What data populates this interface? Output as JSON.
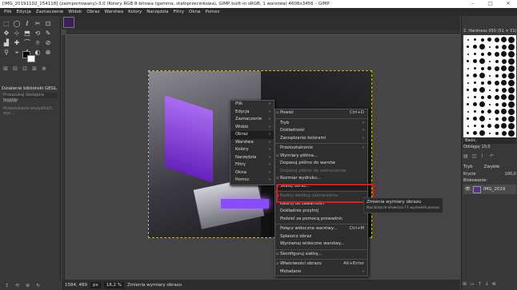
{
  "window": {
    "title": "[IMG_20191102_154118] (zaimportowany)-3.0 (Kolory RGB 8-bitowa (gamma, stałoprzecinkowa), GIMP built-in sRGB, 1 warstwa) 4608x3456 – GIMP",
    "minimize": "–",
    "maximize": "□",
    "close": "✕"
  },
  "menubar": [
    "Plik",
    "Edycja",
    "Zaznaczenie",
    "Widok",
    "Obraz",
    "Warstwa",
    "Kolory",
    "Narzędzia",
    "Filtry",
    "Okna",
    "Pomoc"
  ],
  "toolbox": {
    "tools": [
      "⬚",
      "◯",
      "ℓ",
      "✂",
      "⊡",
      "✥",
      "⊹",
      "⬒",
      "⟲",
      "✎",
      "▟",
      "✚",
      "⌒",
      "⌾",
      "⊘",
      "⚲",
      "⌖",
      "A",
      "◐",
      "⊕"
    ],
    "panel_icons": [
      "⊞",
      "⊟",
      "⊡",
      "⊠",
      "⊕"
    ],
    "gegl_title": "Działanie biblioteki GEGL",
    "gegl_search": "Przeszukaj dostępne korekty",
    "gegl_preset": "Powrót",
    "gegl_filter": "Przeszukanie wszystkich wyc..."
  },
  "statusbar": {
    "coords": "1584, 489",
    "unit": "px",
    "zoom": "18,2 %",
    "message": "Zmienia wymiary obrazu"
  },
  "bottom_tools": [
    "↥",
    "⟲",
    "⊗",
    "↻"
  ],
  "dock": {
    "brush_header": "2. Hardness 050 (51 × 51)",
    "brush_preset": "Basic,",
    "spacing_label": "Odstępy",
    "spacing_value": "10,0",
    "layer_mode_label": "Tryb",
    "layer_mode_value": "Zwykłe",
    "opacity_label": "Krycie",
    "opacity_value": "100,0",
    "lock_label": "Blokowanie:",
    "layer_name": "IMG_2019",
    "layer_buttons": [
      "⊞",
      "▭",
      "↑",
      "↓",
      "⊗"
    ]
  },
  "image_menu": {
    "items": [
      {
        "label": "Plik",
        "arrow": "›"
      },
      {
        "label": "Edycja",
        "arrow": "›"
      },
      {
        "label": "Zaznaczenie",
        "arrow": "›"
      },
      {
        "label": "Widok",
        "arrow": "›"
      },
      {
        "label": "Obraz",
        "arrow": "›",
        "highlight": true
      },
      {
        "label": "Warstwa",
        "arrow": "›"
      },
      {
        "label": "Kolory",
        "arrow": "›"
      },
      {
        "label": "Narzędzia",
        "arrow": "›"
      },
      {
        "label": "Filtry",
        "arrow": "›"
      },
      {
        "label": "Okna",
        "arrow": "›"
      },
      {
        "label": "Pomoc",
        "arrow": "›"
      }
    ]
  },
  "obraz_menu": {
    "duplicate": "Powiel",
    "duplicate_key": "Ctrl+D",
    "mode": "Tryb",
    "precision": "Dokładność",
    "color_mgmt": "Zarządzanie kolorami",
    "transform": "Przekształcenie",
    "canvas_size": "Wymiary płótna...",
    "fit_canvas_layers": "Dopasuj płótno do warstw",
    "fit_canvas_selection": "Dopasuj płótno do zaznaczenia",
    "print_size": "Rozmiar wydruku...",
    "scale_image": "Skaluj obraz...",
    "crop_selection": "Kadruj według zaznaczenia",
    "crop_content": "Kadruj do zawartości",
    "slice_guides": "Dokładnie przytnij",
    "guillotine": "Podziel za pomocą prowadnic",
    "merge_layers": "Połącz widoczne warstwy...",
    "merge_layers_key": "Ctrl+M",
    "flatten": "Spłaszcz obraz",
    "align_layers": "Wyrównaj widoczne warstwy...",
    "guides": "Skonfiguruj siatkę...",
    "properties": "Właściwości obrazu",
    "properties_key": "Alt+Enter",
    "metadata": "Metadane"
  },
  "tooltip": {
    "title": "Zmienia wymiary obrazu",
    "hint": "Naciśnięcie klawisza F1 wyświetli pomoc"
  }
}
